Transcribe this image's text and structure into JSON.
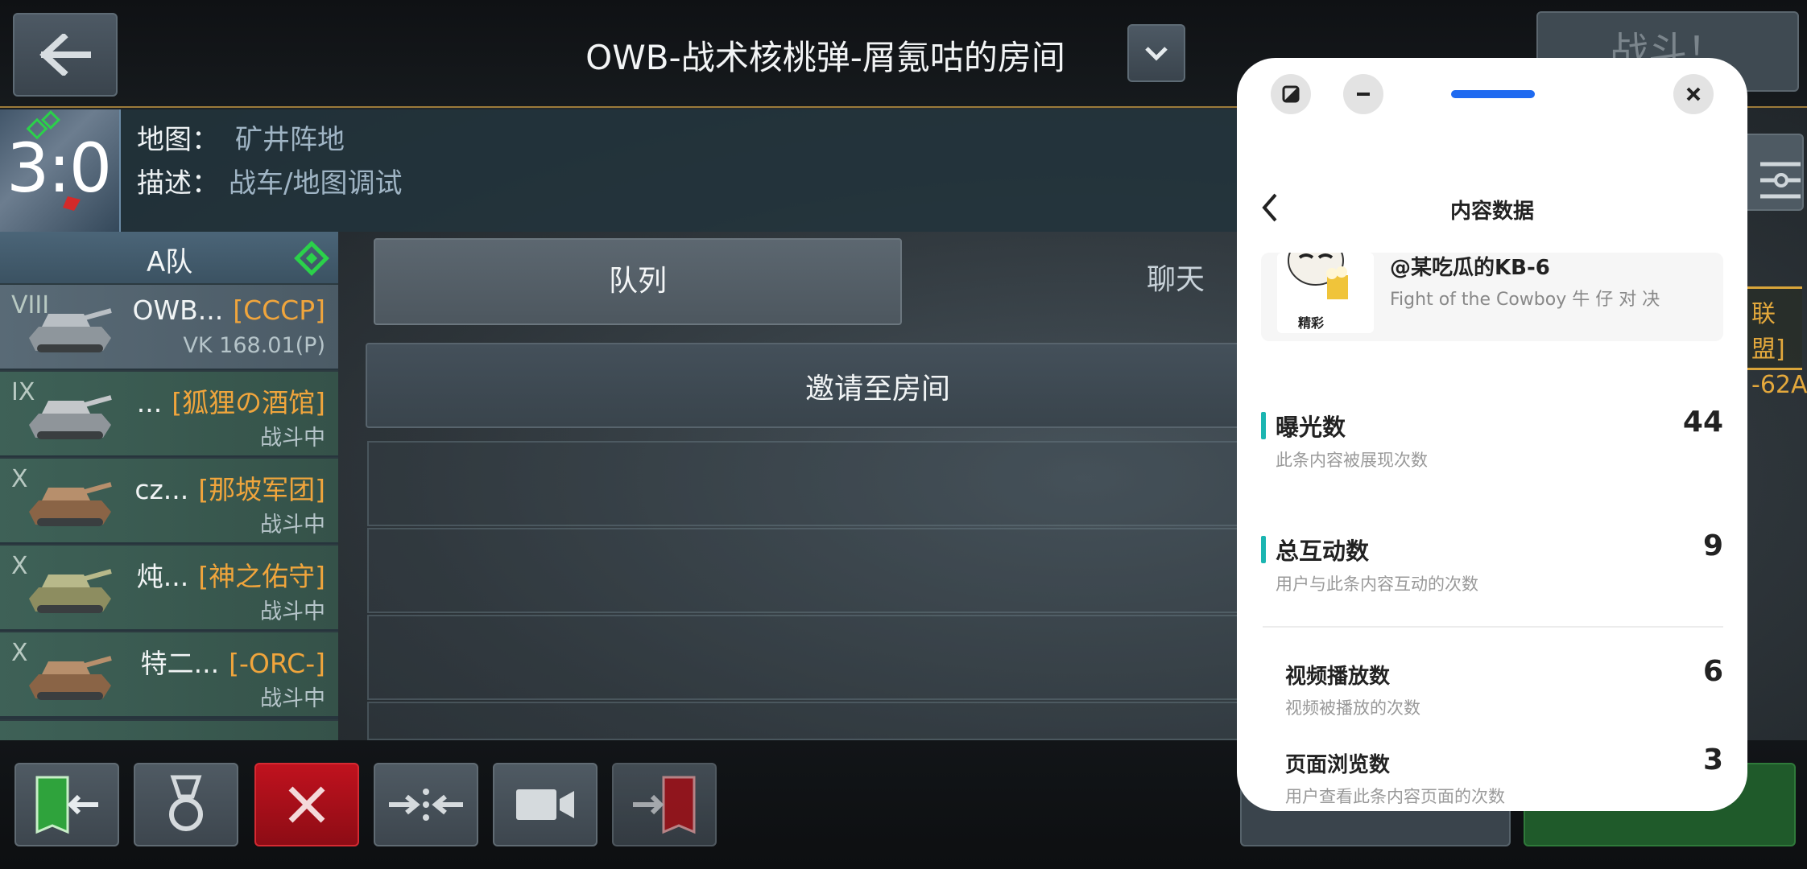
{
  "header": {
    "room_title": "OWB-战术核桃弹-屑氪咕的房间",
    "battle_button": "战斗！"
  },
  "info": {
    "score": "3:0",
    "map_label": "地图：",
    "map_value": "矿井阵地",
    "desc_label": "描述：",
    "desc_value": "战车/地图调试"
  },
  "team": {
    "name": "A队",
    "players": [
      {
        "tier": "VIII",
        "name": "OWB...",
        "clan": "[CCCP]",
        "sub": "VK 168.01(P)",
        "style": "self"
      },
      {
        "tier": "IX",
        "name": "...",
        "clan": "[狐狸の酒馆]",
        "sub": "战斗中",
        "style": "ally"
      },
      {
        "tier": "X",
        "name": "cz...",
        "clan": "[那坡军团]",
        "sub": "战斗中",
        "style": "ally"
      },
      {
        "tier": "X",
        "name": "炖...",
        "clan": "[神之佑守]",
        "sub": "战斗中",
        "style": "ally"
      },
      {
        "tier": "X",
        "name": "特二...",
        "clan": "[-ORC-]",
        "sub": "战斗中",
        "style": "ally"
      }
    ]
  },
  "tabs": {
    "queue": "队列",
    "chat": "聊天"
  },
  "invite_button": "邀请至房间",
  "side_flag": {
    "clan": "联盟]",
    "tank": "-62A"
  },
  "popup": {
    "title": "内容数据",
    "handle": "@某吃瓜的KB-6",
    "post_desc": "Fight of the Cowboy 牛 仔 对 决",
    "avatar_caption": "精彩",
    "metrics": [
      {
        "label": "曝光数",
        "desc": "此条内容被展现次数",
        "value": "44"
      },
      {
        "label": "总互动数",
        "desc": "用户与此条内容互动的次数",
        "value": "9"
      },
      {
        "label": "视频播放数",
        "desc": "视频被播放的次数",
        "value": "6"
      },
      {
        "label": "页面浏览数",
        "desc": "用户查看此条内容页面的次数",
        "value": "3"
      }
    ]
  },
  "colors": {
    "accent_teal": "#1bb5b1",
    "clan_orange": "#f0a53c",
    "popup_handle_blue": "#1f6af0",
    "action_red": "#c0121e"
  },
  "icons": [
    "back-arrow-icon",
    "chevron-down-icon",
    "diamond-icon",
    "exit-door-icon",
    "medal-icon",
    "close-x-icon",
    "merge-arrows-icon",
    "camera-icon",
    "join-door-icon",
    "filter-icon",
    "pip-icon",
    "minimize-icon",
    "close-icon",
    "chevron-left-icon"
  ]
}
